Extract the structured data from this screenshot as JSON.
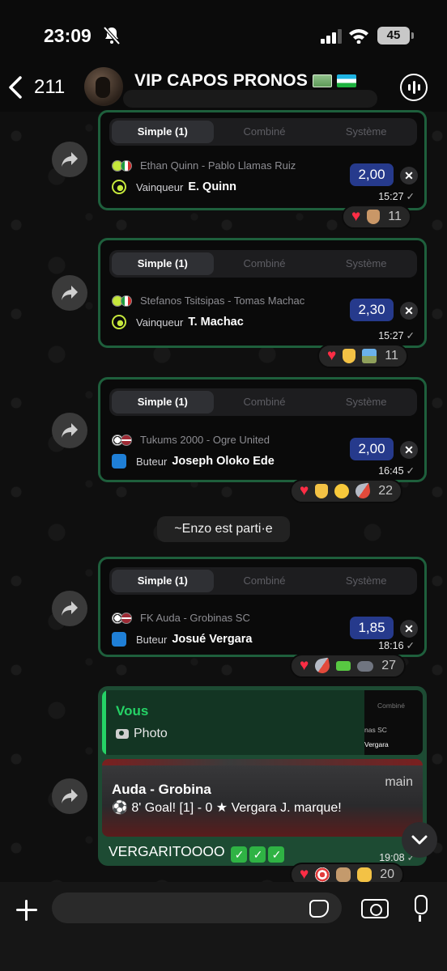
{
  "status_bar": {
    "time": "23:09",
    "battery": "45"
  },
  "header": {
    "back_count": "211",
    "title": "VIP CAPOS PRONOS"
  },
  "tabs": [
    "Simple (1)",
    "Combiné",
    "Système"
  ],
  "bets": [
    {
      "match": "Ethan Quinn - Pablo Llamas Ruiz",
      "market": "Vainqueur",
      "selection": "E. Quinn",
      "odds": "2,00",
      "time": "15:27",
      "reaction_count": "11"
    },
    {
      "match": "Stefanos Tsitsipas - Tomas Machac",
      "market": "Vainqueur",
      "selection": "T. Machac",
      "odds": "2,30",
      "time": "15:27",
      "reaction_count": "11"
    },
    {
      "match": "Tukums 2000 - Ogre United",
      "market": "Buteur",
      "selection": "Joseph Oloko Ede",
      "odds": "2,00",
      "time": "16:45",
      "reaction_count": "22"
    },
    {
      "match": "FK Auda - Grobinas SC",
      "market": "Buteur",
      "selection": "Josué Vergara",
      "odds": "1,85",
      "time": "18:16",
      "reaction_count": "27"
    }
  ],
  "system_message": "~Enzo est parti·e",
  "last_message": {
    "reply_name": "Vous",
    "reply_photo": "Photo",
    "thumb_tab": "Combiné",
    "thumb_match": "nas SC",
    "thumb_player": "Vergara",
    "notif_title": "Auda - Grobina",
    "notif_source": "main",
    "notif_body": "⚽ 8' Goal! [1] - 0 ★ Vergara J. marque!",
    "text": "VERGARITOOOO",
    "time": "19:08",
    "reaction_count": "20"
  },
  "icons": {
    "reactions_1": [
      "heart-emoji",
      "thumbs-up-emoji"
    ],
    "reactions_2": [
      "heart-emoji",
      "thumbs-up-emoji",
      "railway-emoji"
    ],
    "reactions_3": [
      "heart-emoji",
      "thumbs-up-emoji",
      "sunglasses-emoji",
      "rocket-emoji"
    ],
    "reactions_4": [
      "heart-emoji",
      "rocket-emoji",
      "water-pistol-emoji",
      "gamepad-emoji"
    ],
    "reactions_5": [
      "heart-emoji",
      "target-emoji",
      "goat-emoji",
      "fist-emoji"
    ]
  },
  "colors": {
    "accent": "#25d366",
    "bubble_out": "#1d4b33",
    "card_border": "#1e5f3c",
    "odds": "#263a8c"
  }
}
